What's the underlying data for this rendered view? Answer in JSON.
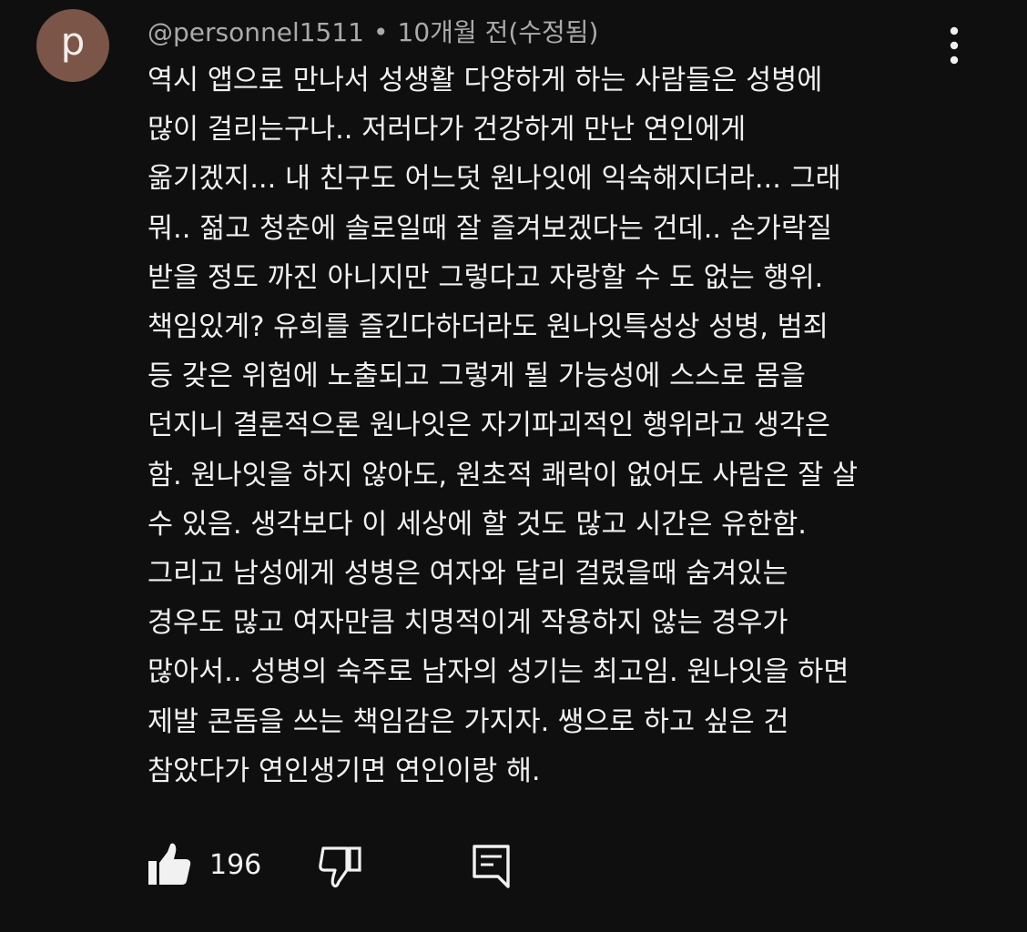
{
  "comment": {
    "avatar_letter": "p",
    "author": "@personnel1511",
    "separator": "•",
    "time": "10개월 전(수정됨)",
    "lines": [
      "역시 앱으로 만나서 성생활 다양하게 하는 사람들은 성병에",
      "많이 걸리는구나.. 저러다가 건강하게 만난 연인에게",
      "옮기겠지... 내 친구도 어느덧 원나잇에 익숙해지더라... 그래",
      "뭐.. 젊고 청춘에 솔로일때 잘 즐겨보겠다는 건데.. 손가락질",
      "받을 정도 까진 아니지만 그렇다고 자랑할 수 도 없는 행위.",
      "책임있게? 유희를 즐긴다하더라도 원나잇특성상 성병, 범죄",
      "등 갖은 위험에 노출되고 그렇게 될 가능성에 스스로 몸을",
      "던지니 결론적으론 원나잇은 자기파괴적인 행위라고 생각은",
      "함. 원나잇을 하지 않아도, 원초적 쾌락이 없어도 사람은 잘 살",
      "수 있음. 생각보다 이 세상에 할 것도 많고 시간은 유한함.",
      "그리고 남성에게 성병은 여자와 달리 걸렸을때 숨겨있는",
      "경우도 많고 여자만큼 치명적이게 작용하지 않는 경우가",
      "많아서.. 성병의 숙주로 남자의 성기는 최고임. 원나잇을 하면",
      "제발 콘돔을 쓰는 책임감은 가지자. 쌩으로 하고 싶은 건",
      "참았다가 연인생기면 연인이랑 해."
    ],
    "like_count": "196"
  },
  "icons": {
    "more": "more-vert-icon",
    "like": "thumb-up-filled-icon",
    "dislike": "thumb-down-outline-icon",
    "reply": "reply-comment-icon"
  },
  "colors": {
    "background": "#0f0f0f",
    "avatar": "#7a5548",
    "text": "#f1f1f1",
    "meta_text": "#aaaaaa"
  }
}
